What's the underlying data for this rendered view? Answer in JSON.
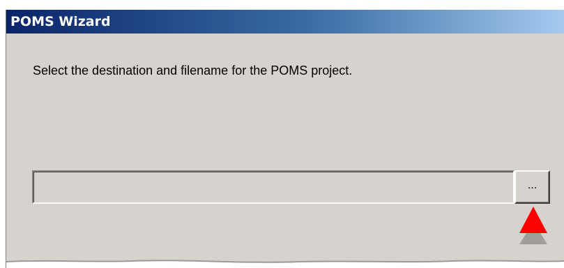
{
  "window": {
    "title": "POMS Wizard"
  },
  "wizard": {
    "instruction": "Select the destination and filename for the POMS project.",
    "path_value": "",
    "browse_label": "..."
  },
  "annotation": {
    "pointer_icon": "red-arrow-pointer-icon",
    "pointer_color": "#ff0000"
  }
}
